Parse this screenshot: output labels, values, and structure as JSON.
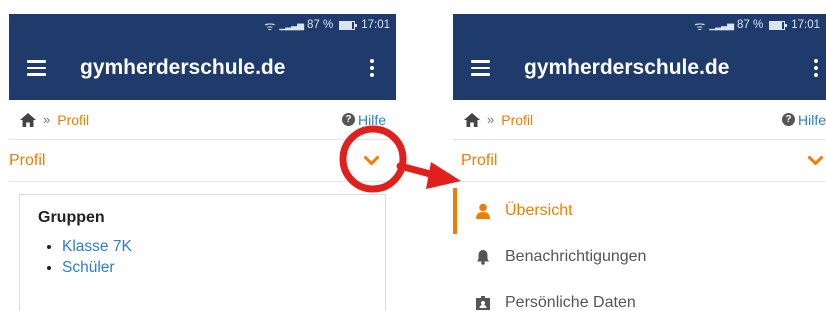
{
  "status_bar": {
    "battery_percent": "87 %",
    "time": "17:01"
  },
  "app_bar": {
    "title": "gymherderschule.de"
  },
  "breadcrumb": {
    "separator": "»",
    "current": "Profil",
    "help_label": "Hilfe"
  },
  "section": {
    "label": "Profil"
  },
  "groups_card": {
    "title": "Gruppen",
    "items": [
      "Klasse 7K",
      "Schüler"
    ]
  },
  "profile_menu": {
    "items": [
      {
        "label": "Übersicht",
        "icon": "user-icon",
        "active": true
      },
      {
        "label": "Benachrichtigungen",
        "icon": "bell-icon",
        "active": false
      },
      {
        "label": "Persönliche Daten",
        "icon": "id-card-icon",
        "active": false
      }
    ]
  },
  "colors": {
    "header": "#1e3b6c",
    "accent": "#ef7d00",
    "link": "#2a7fd4",
    "annotation": "#e0201c"
  },
  "icons": [
    "wifi-icon",
    "signal-icon",
    "battery-icon",
    "hamburger-icon",
    "kebab-icon",
    "home-icon",
    "help-icon",
    "chevron-down-icon"
  ]
}
